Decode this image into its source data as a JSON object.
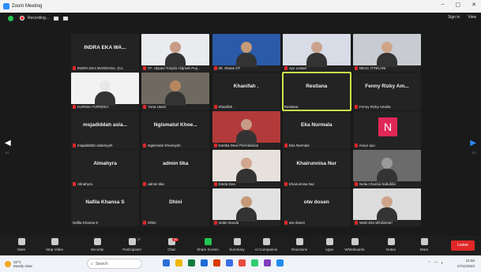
{
  "window": {
    "title": "Zoom Meeting",
    "controls": [
      "–",
      "▢",
      "✕"
    ]
  },
  "topbar": {
    "recording": "Recording...",
    "signin": "Sign in",
    "view": "View"
  },
  "nav": {
    "left_page": "1/2",
    "right_page": "1/2"
  },
  "tiles": [
    {
      "name": "INDRA EKA WA...",
      "label": "INDRA EKA WARDANA. (Co",
      "type": "name",
      "muted": true
    },
    {
      "name": "",
      "label": "07. Ulyatul Yusyita Hiqmah Puji...",
      "type": "video",
      "skin": "#c79b86",
      "bg": "#e9ebee",
      "muted": true
    },
    {
      "name": "",
      "label": "08. Shane CF",
      "type": "video",
      "skin": "#c69a78",
      "bg": "#2a5aa8",
      "muted": true
    },
    {
      "name": "",
      "label": "Ayu Lestari",
      "type": "video",
      "skin": "#c9a38c",
      "bg": "#d7dce6",
      "muted": true
    },
    {
      "name": "",
      "label": "NEAC ITTELANI",
      "type": "video",
      "skin": "#cfa58a",
      "bg": "#c8ccd2",
      "muted": true
    },
    {
      "name": "",
      "label": "KURNIA-TURNISIA",
      "type": "video",
      "skin": "#e8e8e8",
      "bg": "#f2f2f2",
      "muted": true
    },
    {
      "name": "",
      "label": "Yona Utami",
      "type": "video",
      "skin": "#b7865f",
      "bg": "#6f6a60",
      "muted": true
    },
    {
      "name": "Khanifah .",
      "label": "Khanifah .",
      "type": "name",
      "muted": true
    },
    {
      "name": "Restiana",
      "label": "Restiana",
      "type": "name",
      "muted": false,
      "active": true
    },
    {
      "name": "Fenny Rizky Am...",
      "label": "Fenny Rizky Amelia",
      "type": "name",
      "muted": true
    },
    {
      "name": "msjadiddah asla...",
      "label": "msjadiddah aslamiyah",
      "type": "name",
      "muted": true
    },
    {
      "name": "Ngismatul Khoe...",
      "label": "Ngismatul Khoeriyah",
      "type": "name",
      "muted": true
    },
    {
      "name": "",
      "label": "Kartika Dewi Permatasari",
      "type": "video",
      "skin": "#c79b86",
      "bg": "#b23a3a",
      "muted": true
    },
    {
      "name": "Eka Nurmala",
      "label": "Eka Nurmala",
      "type": "name",
      "muted": true
    },
    {
      "name": "",
      "label": "nuryo ayu",
      "type": "avatar",
      "initial": "N",
      "muted": true
    },
    {
      "name": "Almahyra",
      "label": "Almahyra",
      "type": "name",
      "muted": true
    },
    {
      "name": "admin tika",
      "label": "admin tika",
      "type": "name",
      "muted": true
    },
    {
      "name": "",
      "label": "Dinda Dea",
      "type": "video",
      "skin": "#d2a68e",
      "bg": "#e6e1dc",
      "muted": true
    },
    {
      "name": "Khairunnisa Nur",
      "label": "Khairunnisa Nur",
      "type": "name",
      "muted": true
    },
    {
      "name": "",
      "label": "Nelia Charisa Sabubila",
      "type": "video",
      "skin": "#9a9a9a",
      "bg": "#6b6b6b",
      "muted": true
    },
    {
      "name": "Nafila Khansa S",
      "label": "Nafila Khansa S",
      "type": "name",
      "muted": false
    },
    {
      "name": "Dhini",
      "label": "Dhini",
      "type": "name",
      "muted": true
    },
    {
      "name": "",
      "label": "Indah Nanda",
      "type": "video",
      "skin": "#c69a78",
      "bg": "#e2e2e2",
      "muted": true
    },
    {
      "name": "otw dosen",
      "label": "otw dosen",
      "type": "name",
      "muted": true
    },
    {
      "name": "",
      "label": "Wahi Elia Windarsari",
      "type": "video",
      "skin": "#cfa58a",
      "bg": "#dcdcdc",
      "muted": true
    }
  ],
  "toolbar": {
    "buttons": [
      {
        "label": "Mute",
        "icon": "microphone-icon"
      },
      {
        "label": "Stop Video",
        "icon": "video-camera-icon"
      },
      {
        "label": "Security",
        "icon": "shield-icon"
      },
      {
        "label": "Participants",
        "icon": "participants-icon",
        "count": "27"
      },
      {
        "label": "Chat",
        "icon": "chat-icon",
        "badge": "25"
      },
      {
        "label": "Share Screen",
        "icon": "share-screen-icon"
      },
      {
        "label": "Summary",
        "icon": "summary-icon"
      },
      {
        "label": "AI Companion",
        "icon": "ai-companion-icon"
      },
      {
        "label": "Reactions",
        "icon": "reactions-icon"
      },
      {
        "label": "Apps",
        "icon": "apps-icon"
      },
      {
        "label": "Whiteboards",
        "icon": "whiteboard-icon"
      },
      {
        "label": "Notes",
        "icon": "notes-icon"
      },
      {
        "label": "More",
        "icon": "more-icon"
      }
    ],
    "leave": "Leave"
  },
  "taskbar": {
    "weather_temp": "32°C",
    "weather_desc": "Mostly clear",
    "search": "Search",
    "time": "21:50",
    "date": "27/11/2023",
    "apps": [
      "#2d6fd6",
      "#f2b705",
      "#0f7b3c",
      "#1f6bd6",
      "#d83b01",
      "#3a6ee8",
      "#e74c3c",
      "#2ecc71",
      "#7f3fbf",
      "#1f8ded"
    ]
  }
}
